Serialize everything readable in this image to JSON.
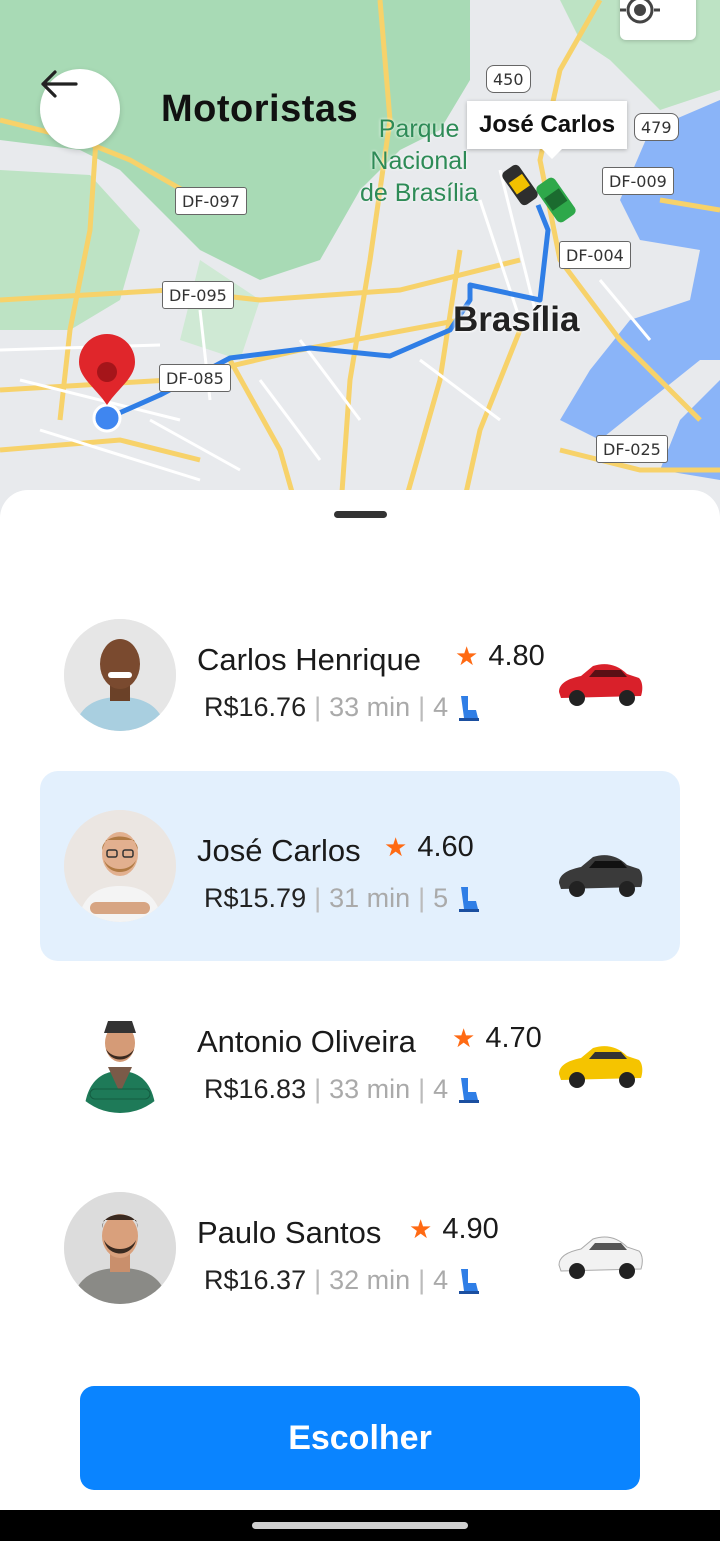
{
  "header": {
    "title": "Motoristas"
  },
  "map": {
    "park_label": "Parque Nacional de Brasília",
    "city_label": "Brasília",
    "selected_car_label": "José Carlos",
    "roads": [
      "DF-097",
      "DF-095",
      "DF-085",
      "450",
      "479",
      "DF-009",
      "DF-004",
      "DF-025"
    ]
  },
  "drivers": [
    {
      "name": "Carlos Henrique",
      "rating": "4.80",
      "price": "R$16.76",
      "time": "33 min",
      "seats": "4",
      "car_color": "#d9202a",
      "selected": false
    },
    {
      "name": "José Carlos",
      "rating": "4.60",
      "price": "R$15.79",
      "time": "31 min",
      "seats": "5",
      "car_color": "#3a3a3a",
      "selected": true
    },
    {
      "name": "Antonio Oliveira",
      "rating": "4.70",
      "price": "R$16.83",
      "time": "33 min",
      "seats": "4",
      "car_color": "#f5c400",
      "selected": false
    },
    {
      "name": "Paulo Santos",
      "rating": "4.90",
      "price": "R$16.37",
      "time": "32 min",
      "seats": "4",
      "car_color": "#f2f2f2",
      "selected": false
    }
  ],
  "actions": {
    "choose_label": "Escolher"
  },
  "colors": {
    "accent": "#0a84ff",
    "selected_bg": "#e3f0fd",
    "star": "#ff6a13",
    "route": "#2f7ee6",
    "pin": "#e0262b"
  }
}
